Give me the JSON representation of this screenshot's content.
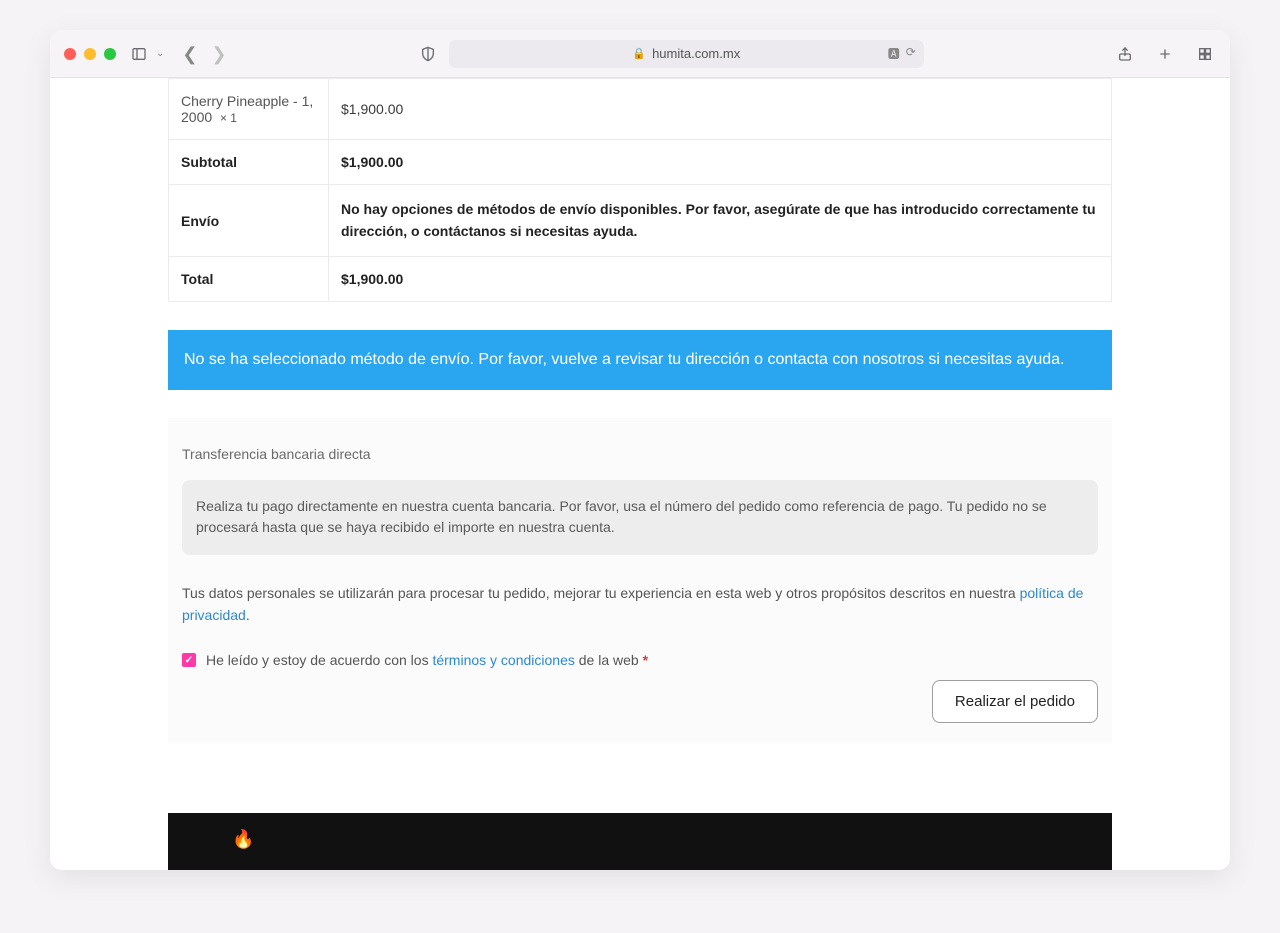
{
  "browser": {
    "url_host": "humita.com.mx"
  },
  "order": {
    "product_name": "Cherry Pineapple - 1, 2000",
    "product_qty": "× 1",
    "product_price": "$1,900.00",
    "subtotal_label": "Subtotal",
    "subtotal_value": "$1,900.00",
    "shipping_label": "Envío",
    "shipping_message": "No hay opciones de métodos de envío disponibles. Por favor, asegúrate de que has introducido correctamente tu dirección, o contáctanos si necesitas ayuda.",
    "total_label": "Total",
    "total_value": "$1,900.00"
  },
  "notice": "No se ha seleccionado método de envío. Por favor, vuelve a revisar tu dirección o contacta con nosotros si necesitas ayuda.",
  "payment": {
    "method_title": "Transferencia bancaria directa",
    "method_desc": "Realiza tu pago directamente en nuestra cuenta bancaria. Por favor, usa el número del pedido como referencia de pago. Tu pedido no se procesará hasta que se haya recibido el importe en nuestra cuenta.",
    "privacy_text": "Tus datos personales se utilizarán para procesar tu pedido, mejorar tu experiencia en esta web y otros propósitos descritos en nuestra ",
    "privacy_link": "política de privacidad",
    "terms_pre": "He leído y estoy de acuerdo con los ",
    "terms_link": "términos y condiciones",
    "terms_post": " de la web ",
    "submit_label": "Realizar el pedido"
  }
}
